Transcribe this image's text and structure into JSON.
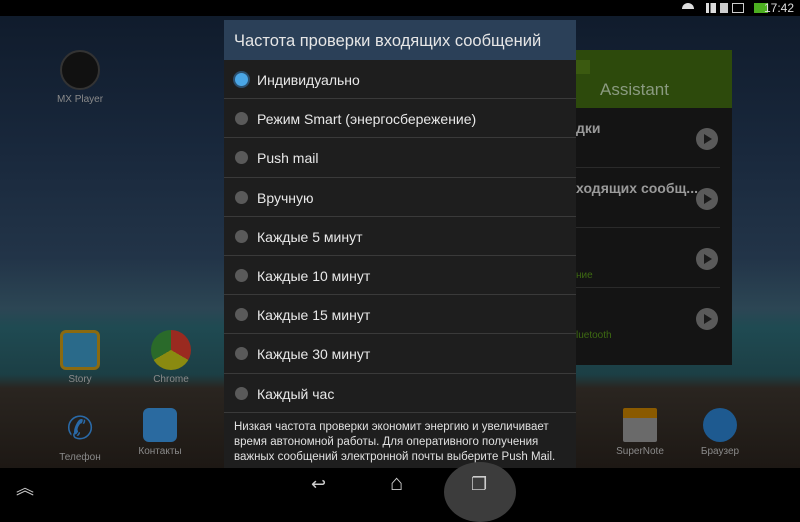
{
  "status": {
    "time": "17:42",
    "icons": [
      "wifi-icon",
      "signal-icon",
      "sim-icon",
      "cast-icon",
      "battery-icon"
    ],
    "battery_color": "#4caf20"
  },
  "home": {
    "apps": [
      {
        "label": "MX Player",
        "icon": "mx-player-icon"
      },
      {
        "label": "Story",
        "icon": "story-icon"
      },
      {
        "label": "Chrome",
        "icon": "chrome-icon"
      },
      {
        "label": "Телефон",
        "icon": "phone-icon"
      },
      {
        "label": "Контакты",
        "icon": "contacts-icon"
      },
      {
        "label": "SuperNote",
        "icon": "supernote-icon"
      },
      {
        "label": "Браузер",
        "icon": "browser-icon"
      }
    ]
  },
  "widget": {
    "title": "Assistant",
    "rows": [
      {
        "title": "дки",
        "sub": ""
      },
      {
        "title": "ходящих сообщ...",
        "sub": ""
      },
      {
        "title": "",
        "sub": "ние"
      },
      {
        "title": "",
        "sub": "luetooth"
      }
    ],
    "accent": "#2d4a0c"
  },
  "dialog": {
    "title": "Частота проверки входящих сообщений",
    "selected": 0,
    "options": [
      "Индивидуально",
      "Режим Smart (энергосбережение)",
      "Push mail",
      "Вручную",
      "Каждые 5 минут",
      "Каждые 10 минут",
      "Каждые 15 минут",
      "Каждые 30 минут",
      "Каждый час"
    ],
    "footer": "Низкая частота проверки экономит энергию и увеличивает время автономной работы. Для оперативного получения важных сообщений электронной почты выберите Push Mail.",
    "accent": "#4aa6e6"
  },
  "nav": {
    "up": "︽",
    "back": "↩",
    "home": "⌂",
    "recent": "❐"
  }
}
